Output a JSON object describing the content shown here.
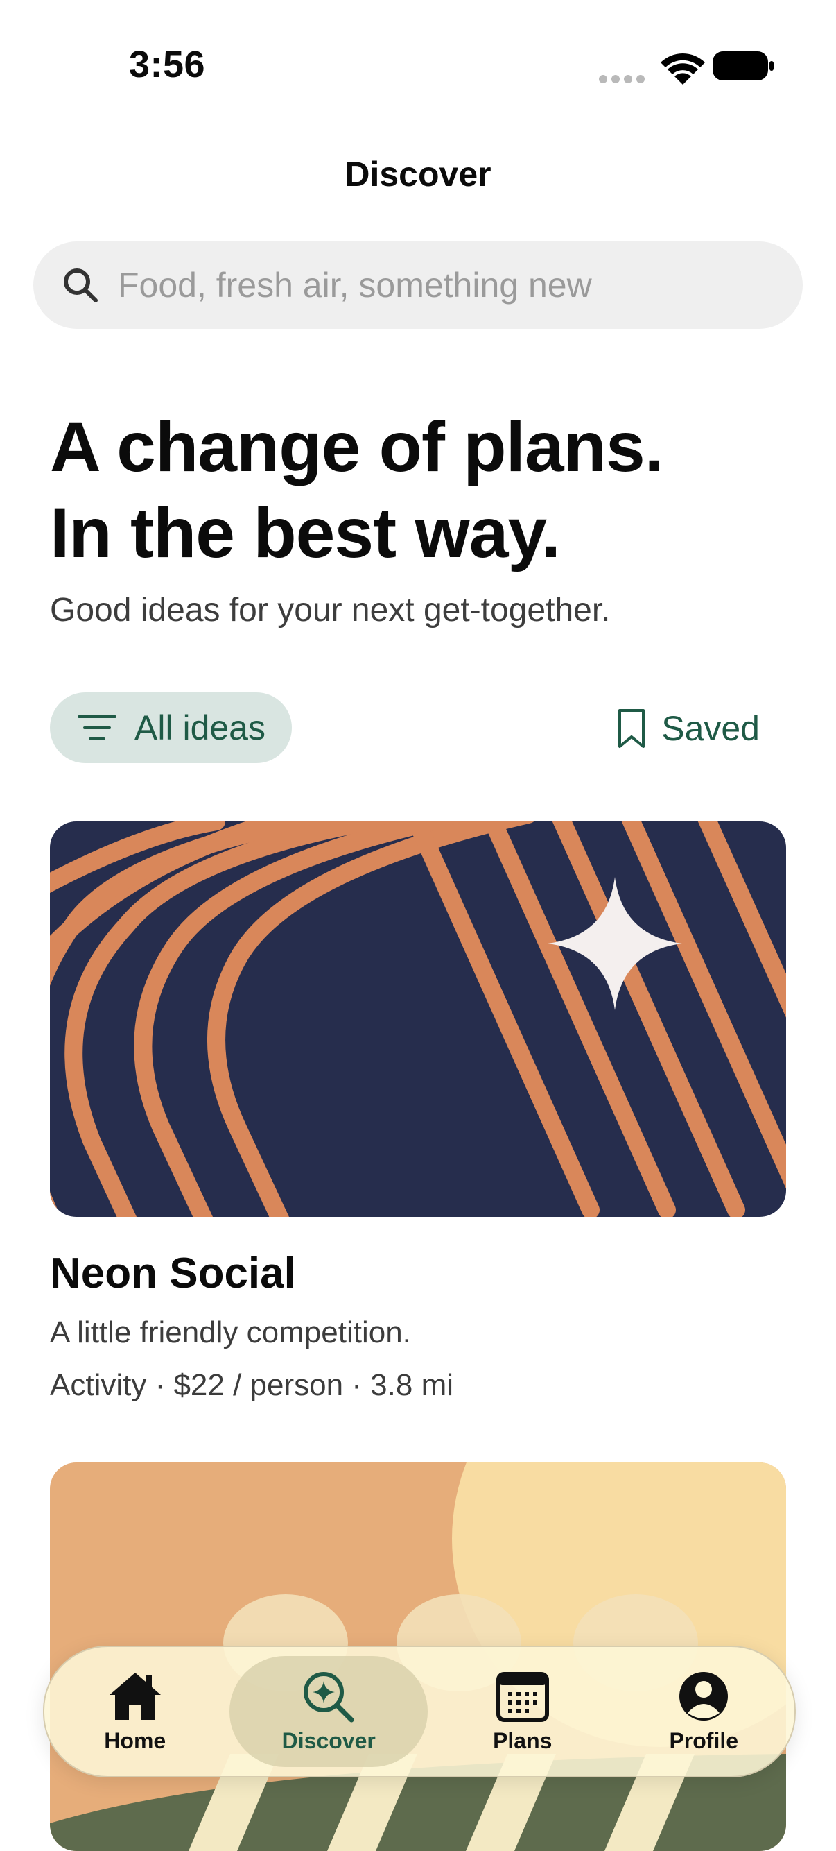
{
  "status_bar": {
    "time": "3:56"
  },
  "nav": {
    "title": "Discover"
  },
  "search": {
    "placeholder": "Food, fresh air, something new"
  },
  "hero": {
    "title_line1": "A change of plans.",
    "title_line2": "In the best way.",
    "subtitle": "Good ideas for your next get-together."
  },
  "filters": {
    "all_ideas_label": "All ideas",
    "saved_label": "Saved"
  },
  "cards": [
    {
      "title": "Neon Social",
      "description": "A little friendly competition.",
      "meta": "Activity · $22 / person · 3.8 mi",
      "art_colors": {
        "background": "#262d4d",
        "stripes": "#d9875a",
        "sparkle": "#f4efee"
      }
    },
    {
      "art_colors": {
        "background": "#e6ad7a",
        "circle": "#f8dca2",
        "ground": "#5e6b4d",
        "stripes": "#f3e9c3"
      }
    }
  ],
  "tabbar": {
    "tabs": [
      {
        "label": "Home",
        "icon": "house-icon"
      },
      {
        "label": "Discover",
        "icon": "sparkle-search-icon",
        "active": true
      },
      {
        "label": "Plans",
        "icon": "calendar-icon"
      },
      {
        "label": "Profile",
        "icon": "person-circle-icon"
      }
    ]
  },
  "colors": {
    "accent": "#1f5a46",
    "chip_background": "#d9e5e1",
    "search_background": "#efefef"
  }
}
